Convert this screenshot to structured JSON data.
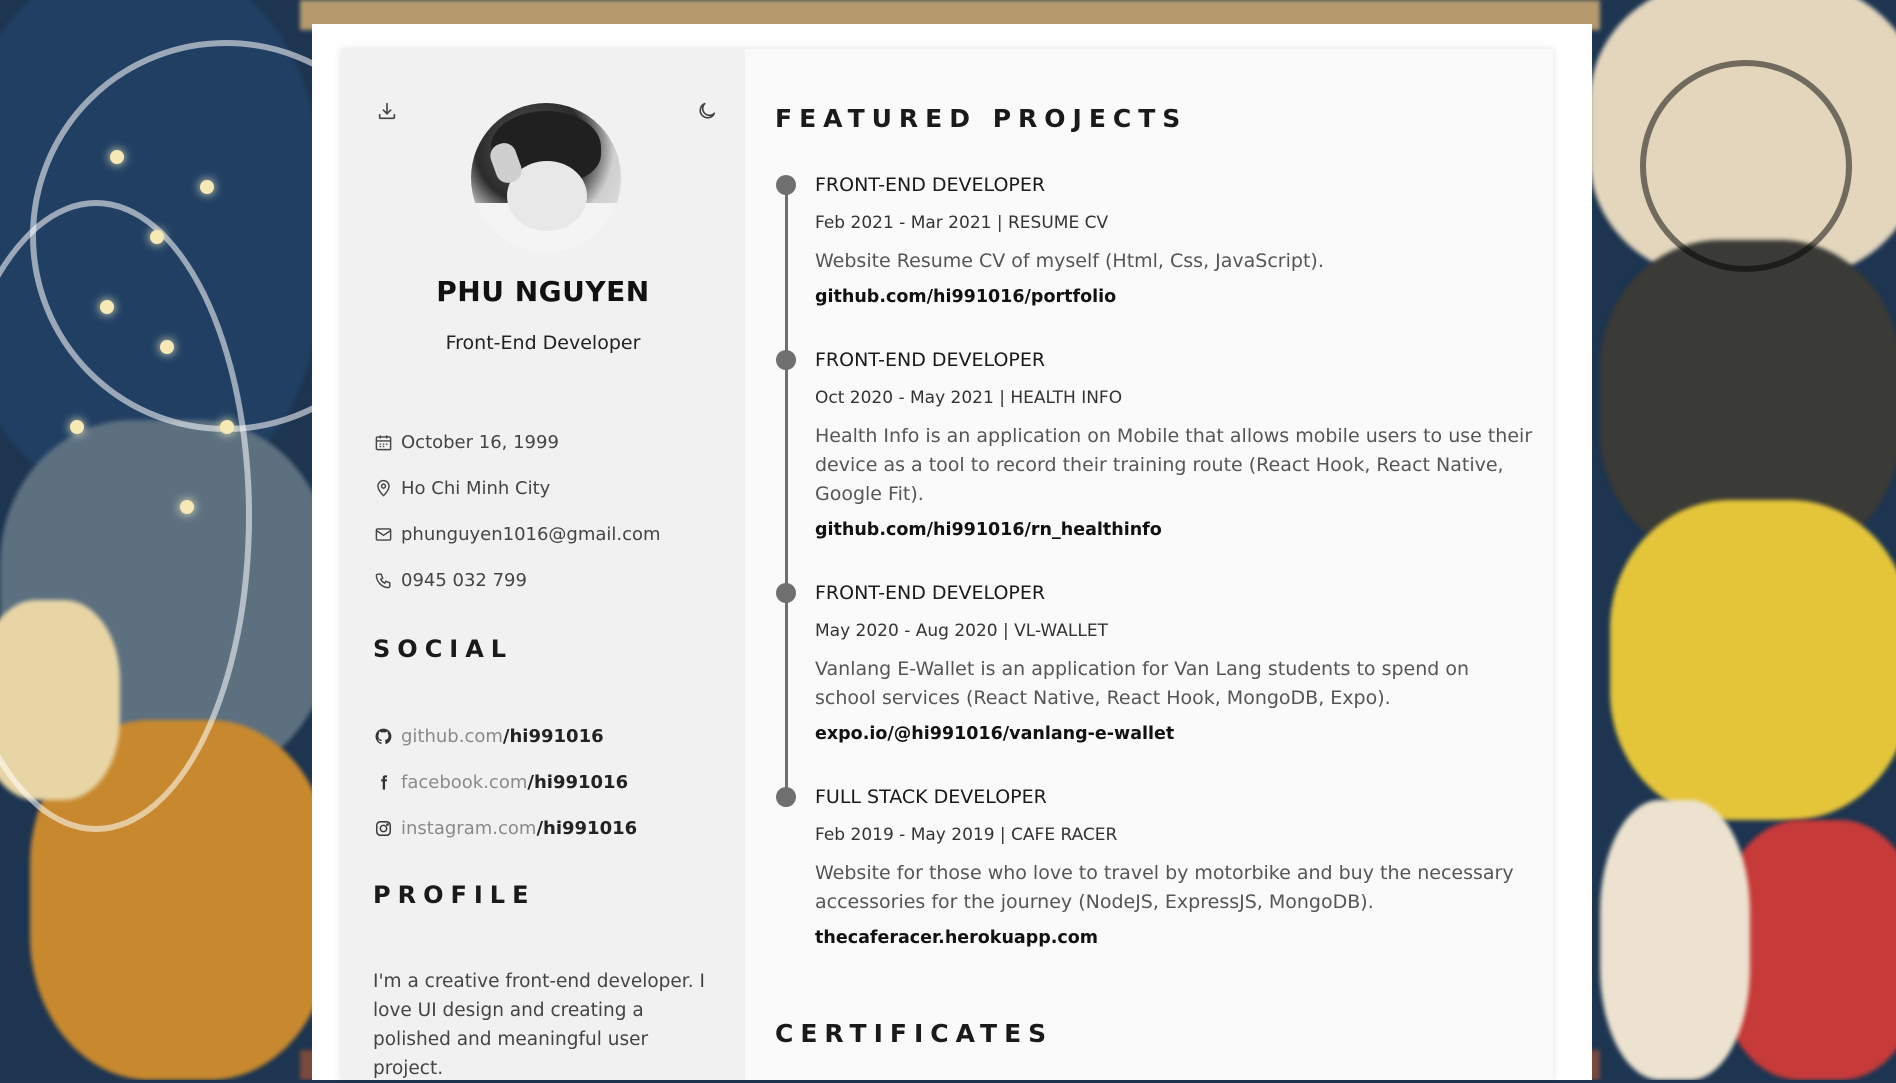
{
  "profile_card": {
    "name": "PHU NGUYEN",
    "role": "Front-End Developer",
    "info": [
      {
        "icon": "calendar-icon",
        "text": "October 16, 1999"
      },
      {
        "icon": "location-pin-icon",
        "text": "Ho Chi Minh City"
      },
      {
        "icon": "mail-icon",
        "text": "phunguyen1016@gmail.com"
      },
      {
        "icon": "phone-icon",
        "text": "0945 032 799"
      }
    ]
  },
  "social": {
    "title": "SOCIAL",
    "items": [
      {
        "icon": "github-icon",
        "domain": "github.com",
        "handle": "/hi991016"
      },
      {
        "icon": "facebook-icon",
        "domain": "facebook.com",
        "handle": "/hi991016"
      },
      {
        "icon": "instagram-icon",
        "domain": "instagram.com",
        "handle": "/hi991016"
      }
    ]
  },
  "profile": {
    "title": "PROFILE",
    "text": "I'm a creative front-end developer. I love UI design and creating a polished and meaningful user project."
  },
  "projects": {
    "title": "FEATURED PROJECTS",
    "items": [
      {
        "title": "FRONT-END DEVELOPER",
        "date": "Feb 2021 - Mar 2021 | RESUME CV",
        "desc": "Website Resume CV of myself (Html, Css, JavaScript).",
        "link": "github.com/hi991016/portfolio"
      },
      {
        "title": "FRONT-END DEVELOPER",
        "date": "Oct 2020 - May 2021 | HEALTH INFO",
        "desc": "Health Info is an application on Mobile that allows mobile users to use their device as a tool to record their training route (React Hook, React Native, Google Fit).",
        "link": "github.com/hi991016/rn_healthinfo"
      },
      {
        "title": "FRONT-END DEVELOPER",
        "date": "May 2020 - Aug 2020 | VL-WALLET",
        "desc": "Vanlang E-Wallet is an application for Van Lang students to spend on school services (React Native, React Hook, MongoDB, Expo).",
        "link": "expo.io/@hi991016/vanlang-e-wallet"
      },
      {
        "title": "FULL STACK DEVELOPER",
        "date": "Feb 2019 - May 2019 | CAFE RACER",
        "desc": "Website for those who love to travel by motorbike and buy the necessary accessories for the journey (NodeJS, ExpressJS, MongoDB).",
        "link": "thecaferacer.herokuapp.com"
      }
    ]
  },
  "certificates": {
    "title": "CERTIFICATES"
  },
  "colors": {
    "sidebar_bg": "#f1f1f1",
    "main_bg": "#fafafa",
    "timeline": "#6f6f6f"
  }
}
